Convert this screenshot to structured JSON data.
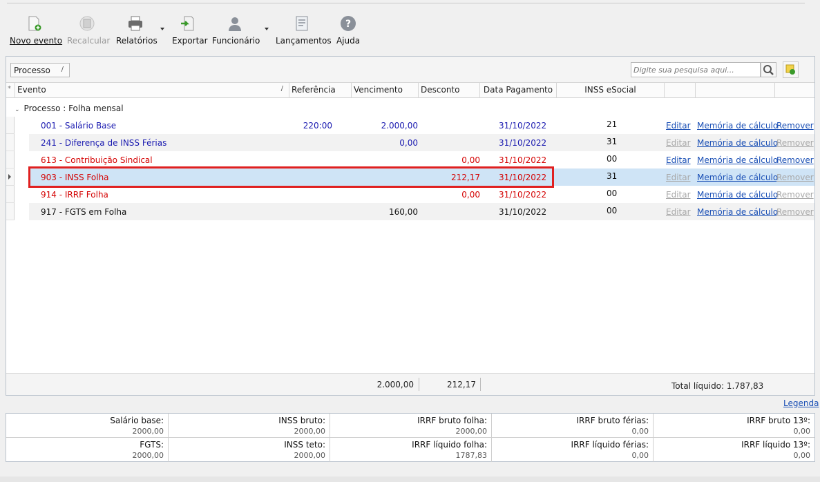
{
  "toolbar": {
    "buttons": [
      {
        "label": "Novo evento",
        "icon": "new-document-icon"
      },
      {
        "label": "Recalcular",
        "icon": "calculator-icon",
        "disabled": true
      },
      {
        "label": "Relatórios",
        "icon": "printer-icon"
      },
      {
        "label": "Exportar",
        "icon": "export-icon"
      },
      {
        "label": "Funcionário",
        "icon": "person-icon"
      },
      {
        "label": "Lançamentos",
        "icon": "document-list-icon"
      },
      {
        "label": "Ajuda",
        "icon": "help-icon"
      }
    ]
  },
  "grid": {
    "group_chip": "Processo",
    "search_placeholder": "Digite sua pesquisa aqui...",
    "columns": [
      "Evento",
      "Referência",
      "Vencimento",
      "Desconto",
      "Data Pagamento",
      "INSS eSocial"
    ],
    "group_label": "Processo : Folha mensal",
    "rows": [
      {
        "evento": "001 - Salário Base",
        "referencia": "220:00",
        "vencimento": "2.000,00",
        "desconto": "",
        "data": "31/10/2022",
        "inss": "21",
        "editar": "Editar",
        "memoria": "Memória de cálculo",
        "remover": "Remover",
        "color": "blue"
      },
      {
        "evento": "241 - Diferença de INSS Férias",
        "referencia": "",
        "vencimento": "0,00",
        "desconto": "",
        "data": "31/10/2022",
        "inss": "31",
        "editar": "Editar",
        "memoria": "Memória de cálculo",
        "remover": "Remover",
        "color": "blue"
      },
      {
        "evento": "613 - Contribuição Sindical",
        "referencia": "",
        "vencimento": "",
        "desconto": "0,00",
        "data": "31/10/2022",
        "inss": "00",
        "editar": "Editar",
        "memoria": "Memória de cálculo",
        "remover": "Remover",
        "color": "red"
      },
      {
        "evento": "903 - INSS Folha",
        "referencia": "",
        "vencimento": "",
        "desconto": "212,17",
        "data": "31/10/2022",
        "inss": "31",
        "editar": "Editar",
        "memoria": "Memória de cálculo",
        "remover": "Remover",
        "color": "red"
      },
      {
        "evento": "914 - IRRF Folha",
        "referencia": "",
        "vencimento": "",
        "desconto": "0,00",
        "data": "31/10/2022",
        "inss": "00",
        "editar": "Editar",
        "memoria": "Memória de cálculo",
        "remover": "Remover",
        "color": "red"
      },
      {
        "evento": "917 - FGTS em Folha",
        "referencia": "",
        "vencimento": "160,00",
        "desconto": "",
        "data": "31/10/2022",
        "inss": "00",
        "editar": "Editar",
        "memoria": "Memória de cálculo",
        "remover": "Remover",
        "color": "black"
      }
    ],
    "footer": {
      "total_vencimento": "2.000,00",
      "total_desconto": "212,17",
      "total_liquido": "Total líquido: 1.787,83"
    }
  },
  "legenda": "Legenda",
  "summary": [
    {
      "label": "Salário base:",
      "value": "2000,00"
    },
    {
      "label": "INSS bruto:",
      "value": "2000,00"
    },
    {
      "label": "IRRF bruto folha:",
      "value": "2000,00"
    },
    {
      "label": "IRRF bruto férias:",
      "value": "0,00"
    },
    {
      "label": "IRRF bruto 13º:",
      "value": "0,00"
    },
    {
      "label": "FGTS:",
      "value": "2000,00"
    },
    {
      "label": "INSS teto:",
      "value": "2000,00"
    },
    {
      "label": "IRRF líquido folha:",
      "value": "1787,83"
    },
    {
      "label": "IRRF líquido férias:",
      "value": "0,00"
    },
    {
      "label": "IRRF líquido 13º:",
      "value": "0,00"
    }
  ]
}
